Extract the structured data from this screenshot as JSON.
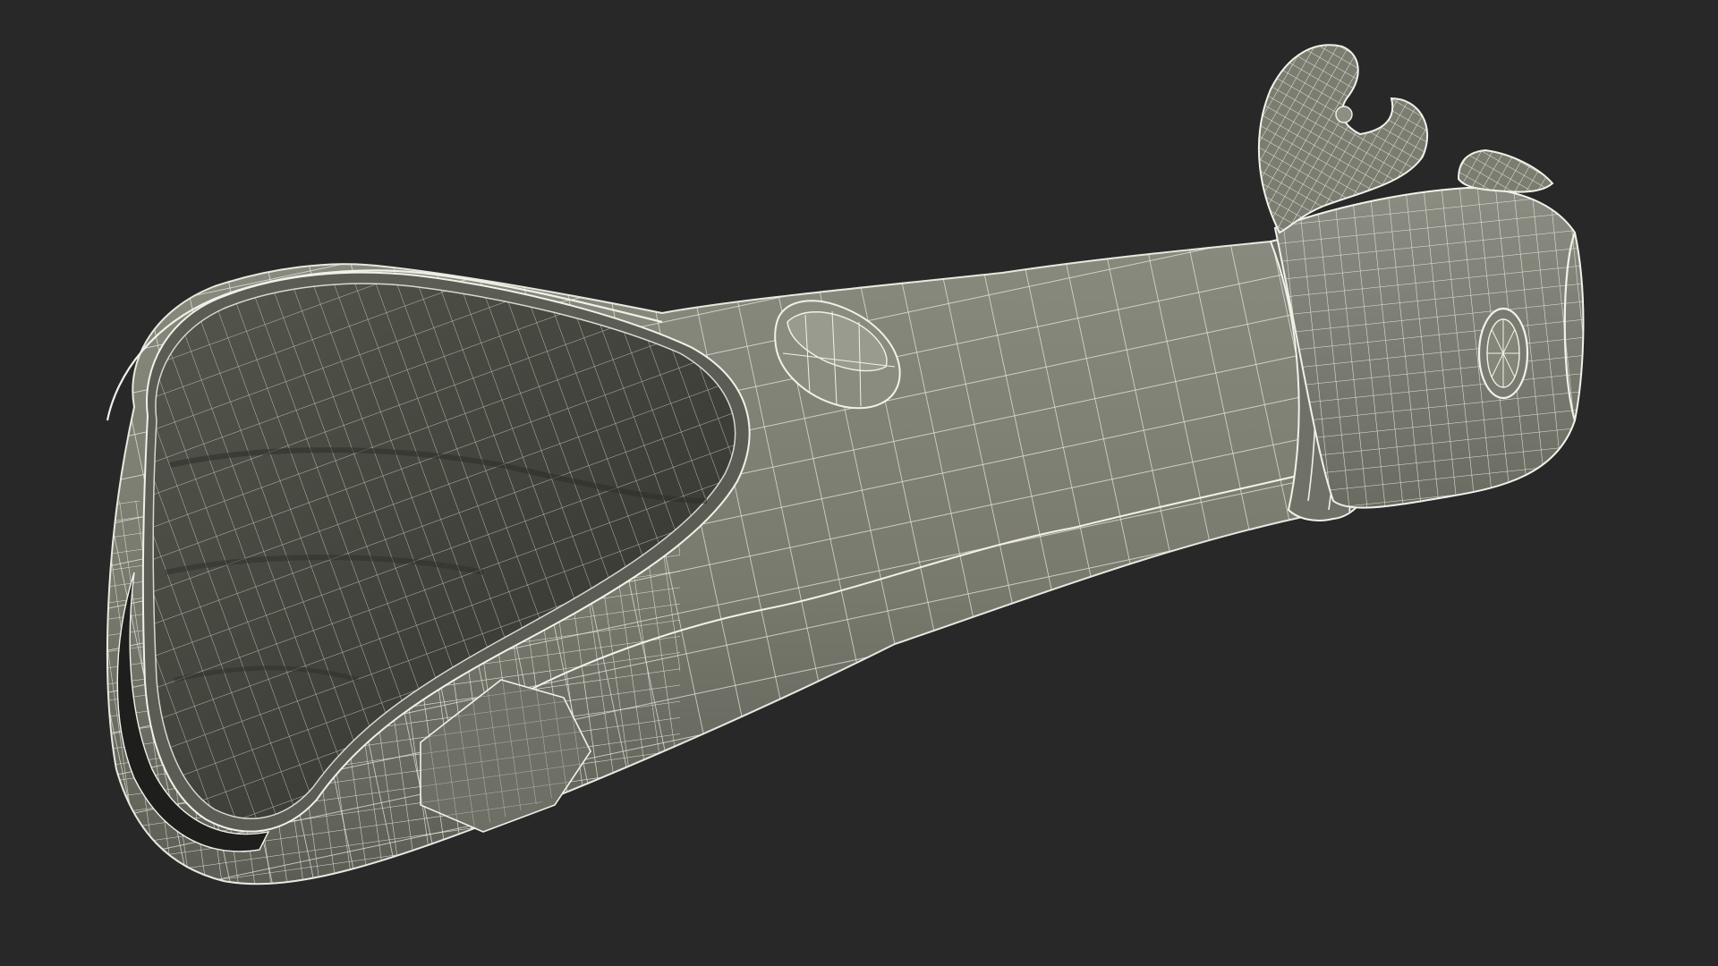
{
  "scene": {
    "background": "#282828",
    "surface_color": "#797a6e",
    "surface_shadow_color": "#4b4c44",
    "interior_color": "#3e3f38",
    "wire_color": "#f1f1ea",
    "parts": [
      "prosthetic-socket",
      "socket-opening",
      "inner-liner",
      "forearm-shell",
      "release-button",
      "wrist-ring",
      "wrist-unit",
      "wrist-dial",
      "hook-finger-upper",
      "hook-finger-lower"
    ]
  }
}
